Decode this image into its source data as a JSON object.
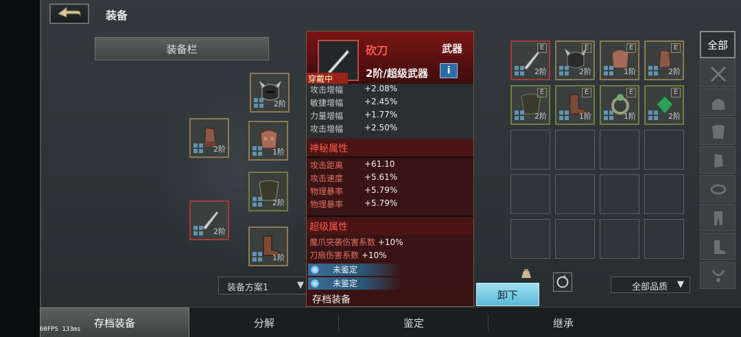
{
  "header": {
    "title": "装备"
  },
  "equip_slots_header": "装备栏",
  "loadout": {
    "selected": "装备方案1"
  },
  "equipped_slots": [
    {
      "id": "helmet",
      "tier": "2阶",
      "icon": "horned-helmet-icon"
    },
    {
      "id": "gloves",
      "tier": "2阶",
      "icon": "gauntlet-icon"
    },
    {
      "id": "armor",
      "tier": "1阶",
      "icon": "chest-armor-icon"
    },
    {
      "id": "cloak",
      "tier": "2阶",
      "icon": "cloak-icon"
    },
    {
      "id": "weapon",
      "tier": "2阶",
      "icon": "knife-icon"
    },
    {
      "id": "boots",
      "tier": "1阶",
      "icon": "boots-icon"
    }
  ],
  "tooltip": {
    "name": "砍刀",
    "type": "武器",
    "grade": "2阶/超级武器",
    "wearing_label": "穿戴中",
    "base_stats": [
      {
        "k": "攻击增幅",
        "v": "+2.08%"
      },
      {
        "k": "敏捷增幅",
        "v": "+2.45%"
      },
      {
        "k": "力量增幅",
        "v": "+1.77%"
      },
      {
        "k": "攻击增幅",
        "v": "+2.50%"
      }
    ],
    "mystic_title": "神秘属性",
    "mystic_stats": [
      {
        "k": "攻击距离",
        "v": "+61.10"
      },
      {
        "k": "攻击速度",
        "v": "+5.61%"
      },
      {
        "k": "物理暴率",
        "v": "+5.79%"
      },
      {
        "k": "物理暴率",
        "v": "+5.79%"
      }
    ],
    "super_title": "超级属性",
    "super_stats": [
      {
        "k": "魔爪突袭伤害系数",
        "v": " +10%"
      },
      {
        "k": "刀扇伤害系数",
        "v": " +10%"
      }
    ],
    "unidentified": [
      "未鉴定",
      "未鉴定"
    ],
    "footer": "存档装备"
  },
  "unequip_label": "卸下",
  "quality_filter": "全部品质",
  "inventory": [
    {
      "tier": "2阶",
      "equipped": "E",
      "icon": "knife-icon",
      "border": "red"
    },
    {
      "tier": "2阶",
      "equipped": "E",
      "icon": "horned-helmet-icon",
      "border": "gold"
    },
    {
      "tier": "1阶",
      "equipped": "E",
      "icon": "chest-armor-icon",
      "border": "gold"
    },
    {
      "tier": "2阶",
      "equipped": "E",
      "icon": "gauntlet-icon",
      "border": "gold"
    },
    {
      "tier": "2阶",
      "equipped": "E",
      "icon": "cloak-icon",
      "border": "green"
    },
    {
      "tier": "1阶",
      "equipped": "E",
      "icon": "boots-icon",
      "border": "green"
    },
    {
      "tier": "1阶",
      "equipped": "E",
      "icon": "ring-icon",
      "border": "green"
    },
    {
      "tier": "2阶",
      "equipped": "E",
      "icon": "amulet-icon",
      "border": "green"
    }
  ],
  "right_tabs": {
    "active_label": "全部",
    "icons": [
      "swords-icon",
      "helmet-icon",
      "armor-icon",
      "gauntlet-icon",
      "belt-icon",
      "legs-icon",
      "boots-icon",
      "necklace-icon"
    ]
  },
  "bottom_tabs": [
    "存档装备",
    "分解",
    "鉴定",
    "继承"
  ],
  "fps": "60FPS   133ms"
}
